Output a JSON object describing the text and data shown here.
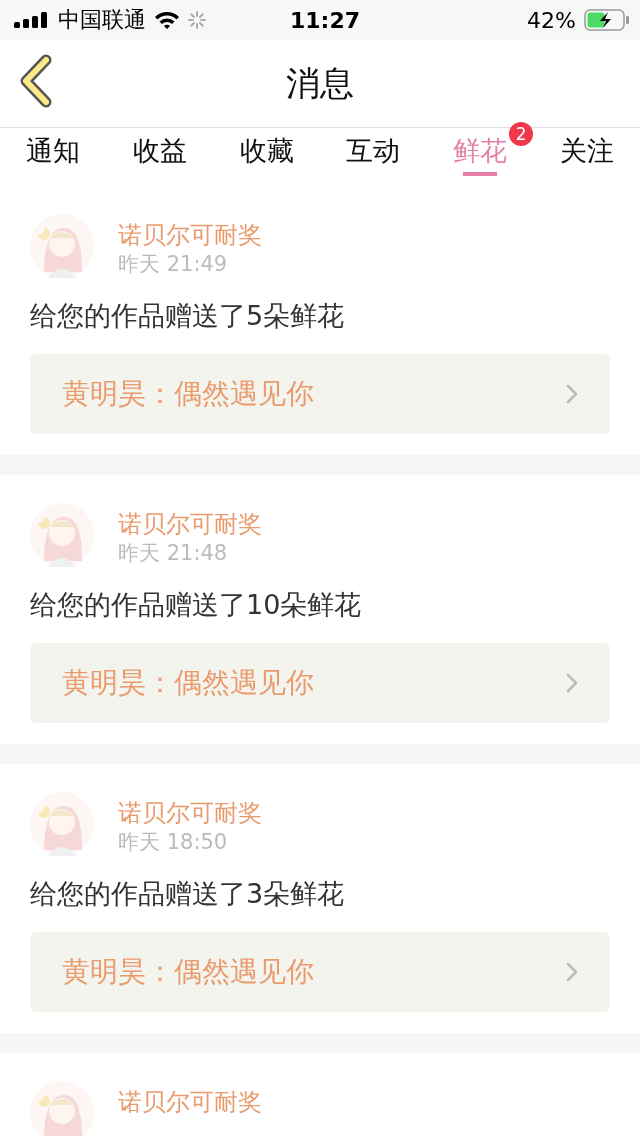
{
  "status_bar": {
    "carrier": "中国联通",
    "time": "11:27",
    "battery": "42%"
  },
  "header": {
    "title": "消息"
  },
  "tabs": [
    {
      "label": "通知",
      "selected": false
    },
    {
      "label": "收益",
      "selected": false
    },
    {
      "label": "收藏",
      "selected": false
    },
    {
      "label": "互动",
      "selected": false
    },
    {
      "label": "鲜花",
      "selected": true,
      "badge": "2"
    },
    {
      "label": "关注",
      "selected": false
    }
  ],
  "messages": [
    {
      "name": "诺贝尔可耐奖",
      "time": "昨天 21:49",
      "text": "给您的作品赠送了5朵鲜花",
      "work": "黄明昊：偶然遇见你"
    },
    {
      "name": "诺贝尔可耐奖",
      "time": "昨天 21:48",
      "text": "给您的作品赠送了10朵鲜花",
      "work": "黄明昊：偶然遇见你"
    },
    {
      "name": "诺贝尔可耐奖",
      "time": "昨天 18:50",
      "text": "给您的作品赠送了3朵鲜花",
      "work": "黄明昊：偶然遇见你"
    },
    {
      "name": "诺贝尔可耐奖"
    }
  ]
}
